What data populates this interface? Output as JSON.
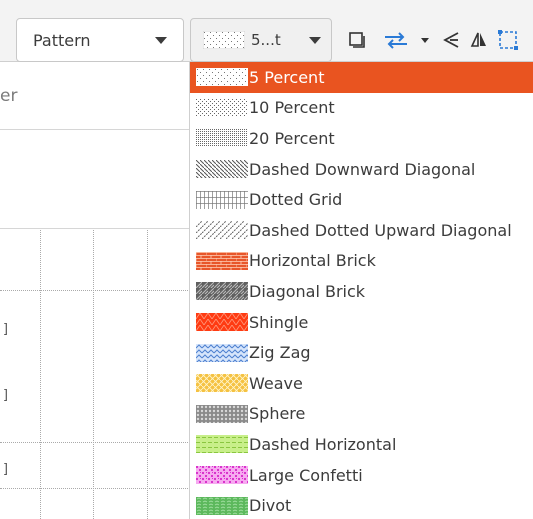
{
  "toolbar": {
    "pattern_label": "Pattern",
    "fill_label": "5...t"
  },
  "sidebar": {
    "header_text": "er"
  },
  "dropdown": {
    "selected_index": 0,
    "accent": "#e95420",
    "items": [
      {
        "label": "5 Percent",
        "swatch": "dots-5"
      },
      {
        "label": "10 Percent",
        "swatch": "dots-10"
      },
      {
        "label": "20 Percent",
        "swatch": "dots-20"
      },
      {
        "label": "Dashed Downward Diagonal",
        "swatch": "dashed-down"
      },
      {
        "label": "Dotted Grid",
        "swatch": "dotted-grid"
      },
      {
        "label": "Dashed Dotted Upward Diagonal",
        "swatch": "dashdot-up"
      },
      {
        "label": "Horizontal Brick",
        "swatch": "h-brick"
      },
      {
        "label": "Diagonal Brick",
        "swatch": "d-brick"
      },
      {
        "label": "Shingle",
        "swatch": "shingle"
      },
      {
        "label": "Zig Zag",
        "swatch": "zigzag"
      },
      {
        "label": "Weave",
        "swatch": "weave"
      },
      {
        "label": "Sphere",
        "swatch": "sphere"
      },
      {
        "label": "Dashed Horizontal",
        "swatch": "dashed-h"
      },
      {
        "label": "Large Confetti",
        "swatch": "confetti"
      },
      {
        "label": "Divot",
        "swatch": "divot"
      }
    ]
  },
  "colors": {
    "brick_red": "#e8562a",
    "diag_gray": "#666666",
    "zigzag_blue": "#5b8fd6",
    "weave_yellow": "#f5c242",
    "dashed_green": "#b7e36b",
    "confetti_pink": "#e64ad9",
    "divot_green": "#5cb85c"
  }
}
